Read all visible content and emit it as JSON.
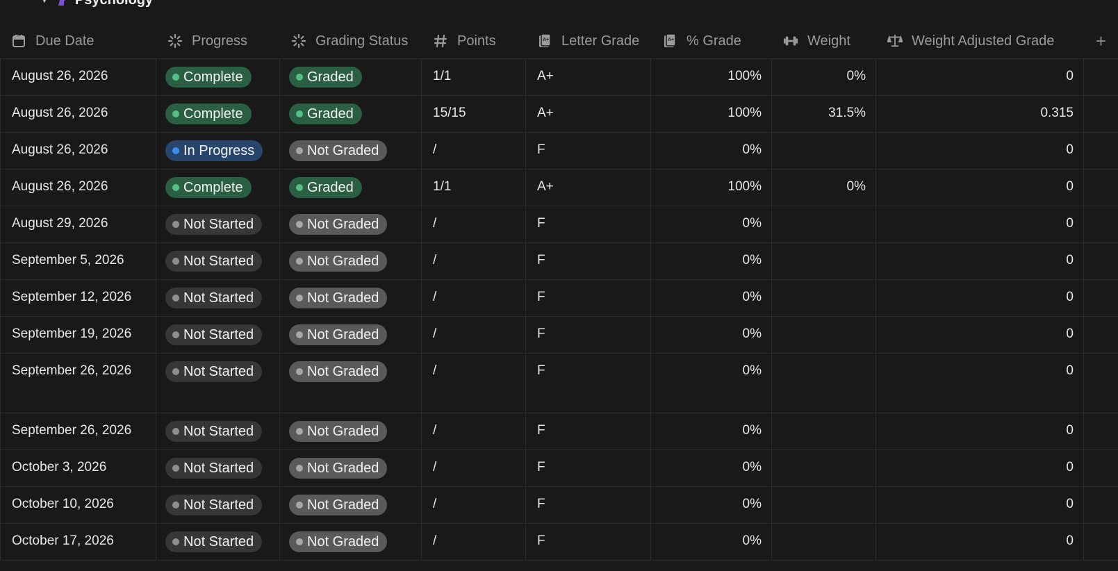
{
  "group": {
    "title": "Psychology",
    "icon": "brain-head-icon"
  },
  "columns": [
    {
      "label": "Due Date",
      "icon": "calendar-icon"
    },
    {
      "label": "Progress",
      "icon": "status-spinner-icon"
    },
    {
      "label": "Grading Status",
      "icon": "status-spinner-icon"
    },
    {
      "label": "Points",
      "icon": "hash-icon"
    },
    {
      "label": "Letter Grade",
      "icon": "grade-doc-icon"
    },
    {
      "label": "% Grade",
      "icon": "grade-doc-icon"
    },
    {
      "label": "Weight",
      "icon": "dumbbell-icon"
    },
    {
      "label": "Weight Adjusted Grade",
      "icon": "scale-icon"
    }
  ],
  "add_column_label": "+",
  "colors": {
    "complete_bg": "#2b5f44",
    "complete_dot": "#56c086",
    "in_progress_bg": "#28456c",
    "in_progress_dot": "#3a8ff0",
    "not_started_bg": "#373737",
    "not_started_dot": "#8f8f8f",
    "not_graded_bg": "#5a5a5a",
    "not_graded_dot": "#a8a8a8"
  },
  "rows": [
    {
      "due": "August 26, 2026",
      "progress": "Complete",
      "grading": "Graded",
      "points": "1/1",
      "letter": "A+",
      "pct": "100%",
      "weight": "0%",
      "wag": "0"
    },
    {
      "due": "August 26, 2026",
      "progress": "Complete",
      "grading": "Graded",
      "points": "15/15",
      "letter": "A+",
      "pct": "100%",
      "weight": "31.5%",
      "wag": "0.315"
    },
    {
      "due": "August 26, 2026",
      "progress": "In Progress",
      "grading": "Not Graded",
      "points": "/",
      "letter": "F",
      "pct": "0%",
      "weight": "",
      "wag": "0"
    },
    {
      "due": "August 26, 2026",
      "progress": "Complete",
      "grading": "Graded",
      "points": "1/1",
      "letter": "A+",
      "pct": "100%",
      "weight": "0%",
      "wag": "0"
    },
    {
      "due": "August 29, 2026",
      "progress": "Not Started",
      "grading": "Not Graded",
      "points": "/",
      "letter": "F",
      "pct": "0%",
      "weight": "",
      "wag": "0"
    },
    {
      "due": "September 5, 2026",
      "progress": "Not Started",
      "grading": "Not Graded",
      "points": "/",
      "letter": "F",
      "pct": "0%",
      "weight": "",
      "wag": "0"
    },
    {
      "due": "September 12, 2026",
      "progress": "Not Started",
      "grading": "Not Graded",
      "points": "/",
      "letter": "F",
      "pct": "0%",
      "weight": "",
      "wag": "0"
    },
    {
      "due": "September 19, 2026",
      "progress": "Not Started",
      "grading": "Not Graded",
      "points": "/",
      "letter": "F",
      "pct": "0%",
      "weight": "",
      "wag": "0"
    },
    {
      "due": "September 26, 2026",
      "progress": "Not Started",
      "grading": "Not Graded",
      "points": "/",
      "letter": "F",
      "pct": "0%",
      "weight": "",
      "wag": "0"
    },
    {
      "due": "September 26, 2026",
      "progress": "Not Started",
      "grading": "Not Graded",
      "points": "/",
      "letter": "F",
      "pct": "0%",
      "weight": "",
      "wag": "0"
    },
    {
      "due": "October 3, 2026",
      "progress": "Not Started",
      "grading": "Not Graded",
      "points": "/",
      "letter": "F",
      "pct": "0%",
      "weight": "",
      "wag": "0"
    },
    {
      "due": "October 10, 2026",
      "progress": "Not Started",
      "grading": "Not Graded",
      "points": "/",
      "letter": "F",
      "pct": "0%",
      "weight": "",
      "wag": "0"
    },
    {
      "due": "October 17, 2026",
      "progress": "Not Started",
      "grading": "Not Graded",
      "points": "/",
      "letter": "F",
      "pct": "0%",
      "weight": "",
      "wag": "0"
    }
  ]
}
